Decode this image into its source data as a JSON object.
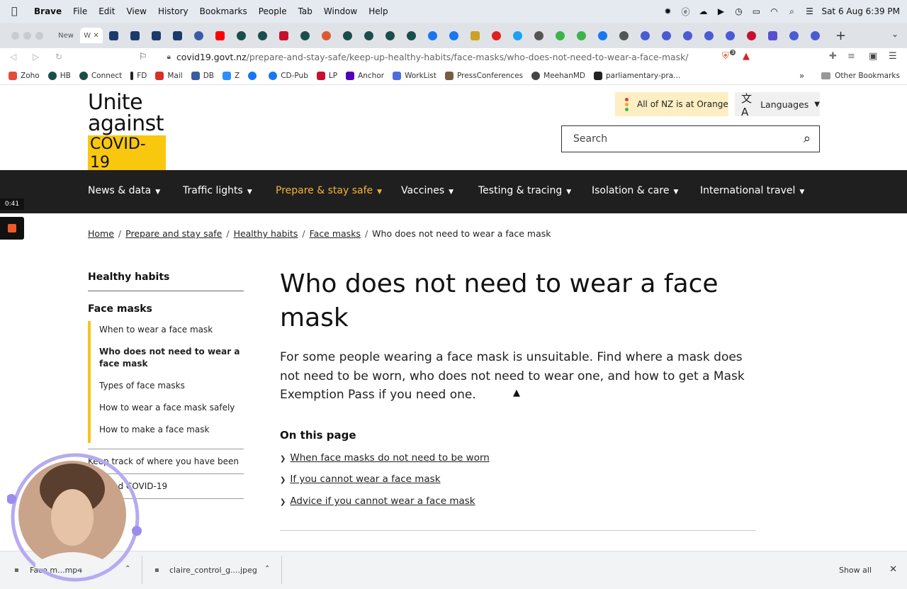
{
  "menubar": {
    "app": "Brave",
    "items": [
      "File",
      "Edit",
      "View",
      "History",
      "Bookmarks",
      "People",
      "Tab",
      "Window",
      "Help"
    ],
    "clock": "Sat 6 Aug  6:39 PM"
  },
  "tabs": {
    "first_label": "New",
    "active_label": "W",
    "close": "✕",
    "new_tab": "+"
  },
  "address": {
    "url_host": "covid19.govt.nz",
    "url_path": "/prepare-and-stay-safe/keep-up-healthy-habits/face-masks/who-does-not-need-to-wear-a-face-mask/",
    "shield_count": "3"
  },
  "bookmarks": {
    "items": [
      {
        "label": "Zoho",
        "color": "#e44d3a"
      },
      {
        "label": "HB",
        "color": "#1b4d4b"
      },
      {
        "label": "Connect",
        "color": "#1b4d4b"
      },
      {
        "label": "FD",
        "color": "#222222"
      },
      {
        "label": "Mail",
        "color": "#d93025"
      },
      {
        "label": "DB",
        "color": "#3b5ba5"
      },
      {
        "label": "Z",
        "color": "#2d8cff"
      },
      {
        "label": "",
        "color": "#1877f2"
      },
      {
        "label": "CD-Pub",
        "color": "#1877f2"
      },
      {
        "label": "LP",
        "color": "#c8102e"
      },
      {
        "label": "Anchor",
        "color": "#5000b9"
      },
      {
        "label": "WorkList",
        "color": "#4a6fdc"
      },
      {
        "label": "PressConferences",
        "color": "#7a5c3e"
      },
      {
        "label": "MeehanMD",
        "color": "#444444"
      },
      {
        "label": "parliamentary-pra...",
        "color": "#222222"
      }
    ],
    "overflow": "»",
    "other": "Other Bookmarks"
  },
  "site": {
    "logo_line1": "Unite",
    "logo_line2": "against",
    "logo_line3": "COVID-19",
    "alert_text": "All of NZ is at Orange",
    "languages": "Languages",
    "search_placeholder": "Search",
    "accent_color": "#f5b335"
  },
  "nav": [
    {
      "label": "News & data",
      "active": false
    },
    {
      "label": "Traffic lights",
      "active": false
    },
    {
      "label": "Prepare & stay safe",
      "active": true
    },
    {
      "label": "Vaccines",
      "active": false
    },
    {
      "label": "Testing & tracing",
      "active": false
    },
    {
      "label": "Isolation & care",
      "active": false
    },
    {
      "label": "International travel",
      "active": false
    }
  ],
  "breadcrumb": {
    "items": [
      "Home",
      "Prepare and stay safe",
      "Healthy habits",
      "Face masks"
    ],
    "current": "Who does not need to wear a face mask"
  },
  "sidebar": {
    "heading": "Healthy habits",
    "section": "Face masks",
    "subitems": [
      {
        "label": "When to wear a face mask",
        "current": false
      },
      {
        "label": "Who does not need to wear a face mask",
        "current": true
      },
      {
        "label": "Types of face masks",
        "current": false
      },
      {
        "label": "How to wear a face mask safely",
        "current": false
      },
      {
        "label": "How to make a face mask",
        "current": false
      }
    ],
    "more": [
      {
        "label": "Keep track of where you have been"
      },
      {
        "label": "...or and COVID-19"
      }
    ]
  },
  "main": {
    "title": "Who does not need to wear a face mask",
    "lead": "For some people wearing a face mask is unsuitable. Find where a mask does not need to be worn, who does not need to wear one, and how to get a Mask Exemption Pass if you need one.",
    "on_this_page": "On this page",
    "links": [
      "When face masks do not need to be worn",
      "If you cannot wear a face mask",
      "Advice if you cannot wear a face mask"
    ]
  },
  "recorder": {
    "timer": "0:41"
  },
  "downloads": {
    "file1": "Face m...mp4",
    "file2": "claire_control_g....jpeg",
    "show_all": "Show all"
  }
}
